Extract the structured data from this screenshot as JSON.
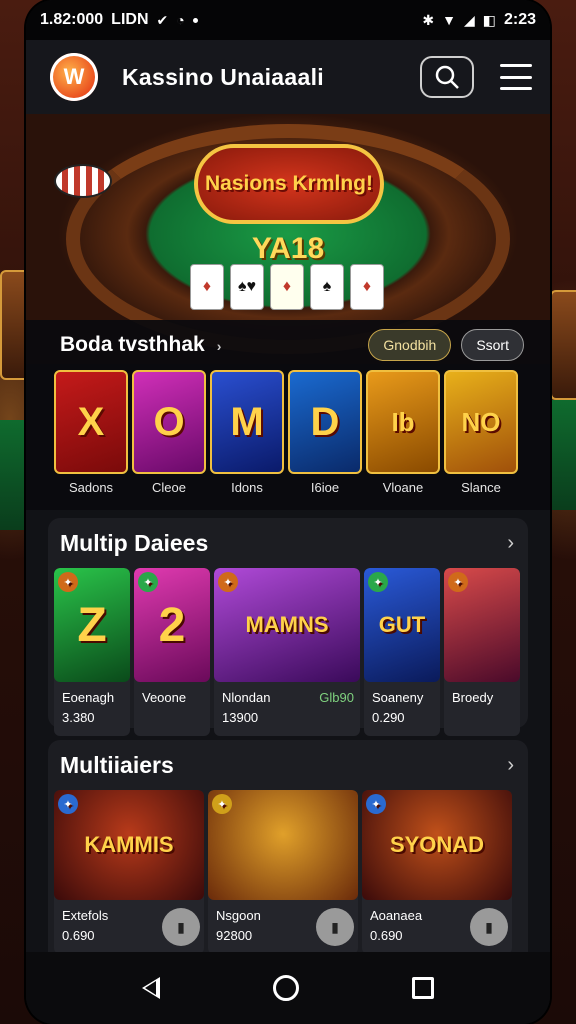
{
  "status_bar": {
    "time": "1.82:000",
    "carrier": "LIDN",
    "right_time": "2:23",
    "battery": "◧"
  },
  "app_bar": {
    "logo_letter": "W",
    "title": "Kassino Unaiaaali"
  },
  "hero": {
    "title": "Nasions Krmlng!",
    "subtitle": "YA18",
    "cards": [
      "♦",
      "♠♥",
      "♦",
      "♠",
      "♦"
    ]
  },
  "slots_section": {
    "title": "Boda tvsthhak",
    "pill_gold": "Gnodbih",
    "pill_dark": "Ssort",
    "items": [
      {
        "art": "X",
        "label": "Sadons",
        "colors": [
          "#c41a1a",
          "#7a0a0a"
        ]
      },
      {
        "art": "O",
        "label": "Cleoe",
        "colors": [
          "#d02fb8",
          "#6a0a6a"
        ]
      },
      {
        "art": "M",
        "label": "Idons",
        "colors": [
          "#2a4fd0",
          "#0a1a6a"
        ]
      },
      {
        "art": "D",
        "label": "I6ioe",
        "colors": [
          "#1a6ad0",
          "#0a2a6a"
        ]
      },
      {
        "art": "Ib",
        "label": "Vloane",
        "colors": [
          "#e89a1a",
          "#8a4a00"
        ]
      },
      {
        "art": "NO",
        "label": "Slance",
        "colors": [
          "#e8b01a",
          "#a0500a"
        ]
      }
    ]
  },
  "multip_section": {
    "title": "Multip Daiees",
    "items": [
      {
        "art": "Z",
        "name": "Eoenagh",
        "value": "3.380",
        "extra": "",
        "colors": [
          "#2ac44a",
          "#0a4a1a"
        ],
        "width": 76
      },
      {
        "art": "2",
        "name": "Veoone",
        "value": "",
        "extra": "",
        "colors": [
          "#e03ab0",
          "#6a0a5a"
        ],
        "width": 76
      },
      {
        "art": "MAMNS",
        "name": "Nlondan",
        "value": "13900",
        "extra": "Glb90",
        "colors": [
          "#b04ad8",
          "#3a0a5a"
        ],
        "width": 146
      },
      {
        "art": "GUT",
        "name": "Soaneny",
        "value": "0.290",
        "extra": "",
        "colors": [
          "#2a5ad8",
          "#0a1a5a"
        ],
        "width": 76
      },
      {
        "art": "",
        "name": "Broedy",
        "value": "",
        "extra": "",
        "colors": [
          "#d84a4a",
          "#4a0a2a"
        ],
        "width": 76
      }
    ]
  },
  "multitalers_section": {
    "title": "Multiiaiers",
    "items": [
      {
        "art": "KAMMIS",
        "name": "Extefols",
        "value": "0.690",
        "colors": [
          "#b83a1a",
          "#3a0a0a"
        ]
      },
      {
        "art": "",
        "name": "Nsgoon",
        "value": "92800",
        "colors": [
          "#e0a02a",
          "#6a2a0a"
        ]
      },
      {
        "art": "SYONAD",
        "name": "Aoanaea",
        "value": "0.690",
        "colors": [
          "#c0501a",
          "#3a0a0a"
        ]
      }
    ]
  },
  "colors": {
    "accent_gold": "#f0c040",
    "panel": "#1c1d22",
    "status_green": "#7fd17f"
  }
}
